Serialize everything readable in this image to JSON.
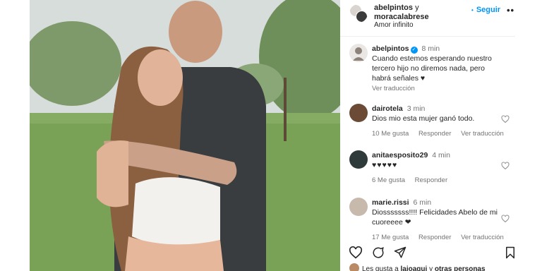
{
  "header": {
    "user1": "abelpintos",
    "connector": "y",
    "user2": "moracalabrese",
    "subtitle": "Amor infinito",
    "follow_label": "Seguir",
    "more_icon": "more-icon"
  },
  "caption": {
    "user": "abelpintos",
    "time": "8 min",
    "text": "Cuando estemos esperando nuestro tercero hijo no diremos nada, pero habrá señales ♥",
    "translate": "Ver traducción"
  },
  "comments": [
    {
      "user": "dairotela",
      "time": "3 min",
      "text": "Dios mio esta mujer ganó todo.",
      "likes": "10 Me gusta",
      "reply": "Responder",
      "translate": "Ver traducción",
      "avatar_color": "#6b4a36"
    },
    {
      "user": "anitaesposito29",
      "time": "4 min",
      "text": "♥♥♥♥♥",
      "likes": "6 Me gusta",
      "reply": "Responder",
      "translate": "",
      "avatar_color": "#2f3a3a"
    },
    {
      "user": "marie.rissi",
      "time": "6 min",
      "text": "Diosssssss!!!! Felicidades Abelo de mi cuoreeee ❤",
      "likes": "17 Me gusta",
      "reply": "Responder",
      "translate": "Ver traducción",
      "avatar_color": "#c7b9ac"
    }
  ],
  "actions": {
    "like_icon": "heart-icon",
    "comment_icon": "comment-icon",
    "share_icon": "share-icon",
    "save_icon": "bookmark-icon"
  },
  "likes_line": {
    "prefix": "Les gusta a",
    "user": "laioagui",
    "connector": "y",
    "others": "otras personas"
  },
  "colors": {
    "link_blue": "#0095f6",
    "muted": "#737373",
    "heart_red": "#ed4956"
  }
}
